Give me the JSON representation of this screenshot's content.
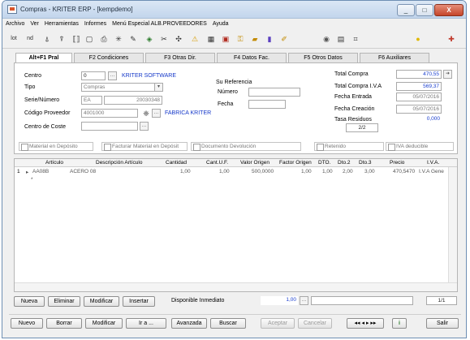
{
  "window": {
    "title": "Compras - KRITER ERP - [kempdemo]",
    "buttons": {
      "minimize": "_",
      "maximize": "□",
      "close": "X"
    }
  },
  "menu": [
    "Archivo",
    "Ver",
    "Herramientas",
    "Informes",
    "Menú Especial ALB.PROVEEDORES",
    "Ayuda"
  ],
  "tabs": [
    "Alt+F1 Pral",
    "F2 Condiciones",
    "F3 Otras Dir.",
    "F4 Datos Fac.",
    "F5 Otros Datos",
    "F6 Auxiliares"
  ],
  "active_tab": 0,
  "form": {
    "centro_label": "Centro",
    "centro_value": "0",
    "centro_name": "KRITER SOFTWARE",
    "tipo_label": "Tipo",
    "tipo_value": "Compras",
    "serie_label": "Serie/Número",
    "serie_value": "EA",
    "numero_value": "20030348",
    "codigo_label": "Código Proveedor",
    "codigo_value": "4001000",
    "proveedor_name": "FABRICA KRITER",
    "coste_label": "Centro de Coste",
    "coste_value": "",
    "ref_title": "Su Referencia",
    "ref_numero_label": "Número",
    "ref_numero_value": "",
    "ref_fecha_label": "Fecha",
    "ref_fecha_value": ""
  },
  "totals": {
    "total_compra_label": "Total Compra",
    "total_compra_value": "470,55",
    "total_iva_label": "Total Compra I.V.A",
    "total_iva_value": "569,37",
    "fecha_entrada_label": "Fecha Entrada",
    "fecha_entrada_value": "05/07/2016",
    "fecha_creacion_label": "Fecha Creación",
    "fecha_creacion_value": "05/07/2016",
    "tasa_label": "Tasa Residuos",
    "tasa_value": "0,000",
    "page_value": "2/2"
  },
  "checkboxes": {
    "material_deposito": "Material en Depósito",
    "facturar_deposito": "Facturar Material en Depósit",
    "documento_devolucion": "Documento Devolución",
    "retenido": "Retenido",
    "iva_deducible": "IVA deducible"
  },
  "grid": {
    "headers": [
      "Artículo",
      "Descripción Artículo",
      "Cantidad",
      "Cant.U.F.",
      "Valor Origen",
      "Factor Origen",
      "DTO.",
      "Dto.2",
      "Dto.3",
      "Precio",
      "I.V.A."
    ],
    "rows": [
      [
        "AA08B",
        "ACERO 08",
        "1,00",
        "1,00",
        "500,0000",
        "1,00",
        "1,00",
        "2,00",
        "3,00",
        "470,5470",
        "I.V.A Gene"
      ]
    ],
    "row_number": "1",
    "new_row_marker": "*"
  },
  "line_buttons": {
    "nueva": "Nueva",
    "eliminar": "Eliminar",
    "modificar": "Modificar",
    "insertar": "Insertar",
    "disponible_label": "Disponible Inmediato",
    "disponible_value": "1,00",
    "page": "1/1"
  },
  "footer_buttons": {
    "nuevo": "Nuevo",
    "borrar": "Borrar",
    "modificar": "Modificar",
    "ir_a": "Ir a ...",
    "avanzada": "Avanzada",
    "buscar": "Buscar",
    "aceptar": "Aceptar",
    "cancelar": "Cancelar",
    "salir": "Salir"
  },
  "toolbar_icons": [
    "lot-icon",
    "nd-icon",
    "filter-first-icon",
    "filter-icon",
    "brackets-icon",
    "preview-icon",
    "print-icon",
    "asterisk-icon",
    "edit-icon",
    "diamond-icon",
    "scissors-icon",
    "tools-icon",
    "warning-icon",
    "calculator-icon",
    "chart-icon",
    "key-icon",
    "folder-icon",
    "bottle-icon",
    "clip-icon",
    "disc-icon",
    "save-icon",
    "grid-icon",
    "lightbulb-icon",
    "help-icon"
  ],
  "toolbar_text": {
    "lot": "lot",
    "nd": "nd"
  },
  "colors": {
    "accent_blue": "#1538c9",
    "window_border": "#6e8fb4",
    "close_red": "#c5452a"
  }
}
